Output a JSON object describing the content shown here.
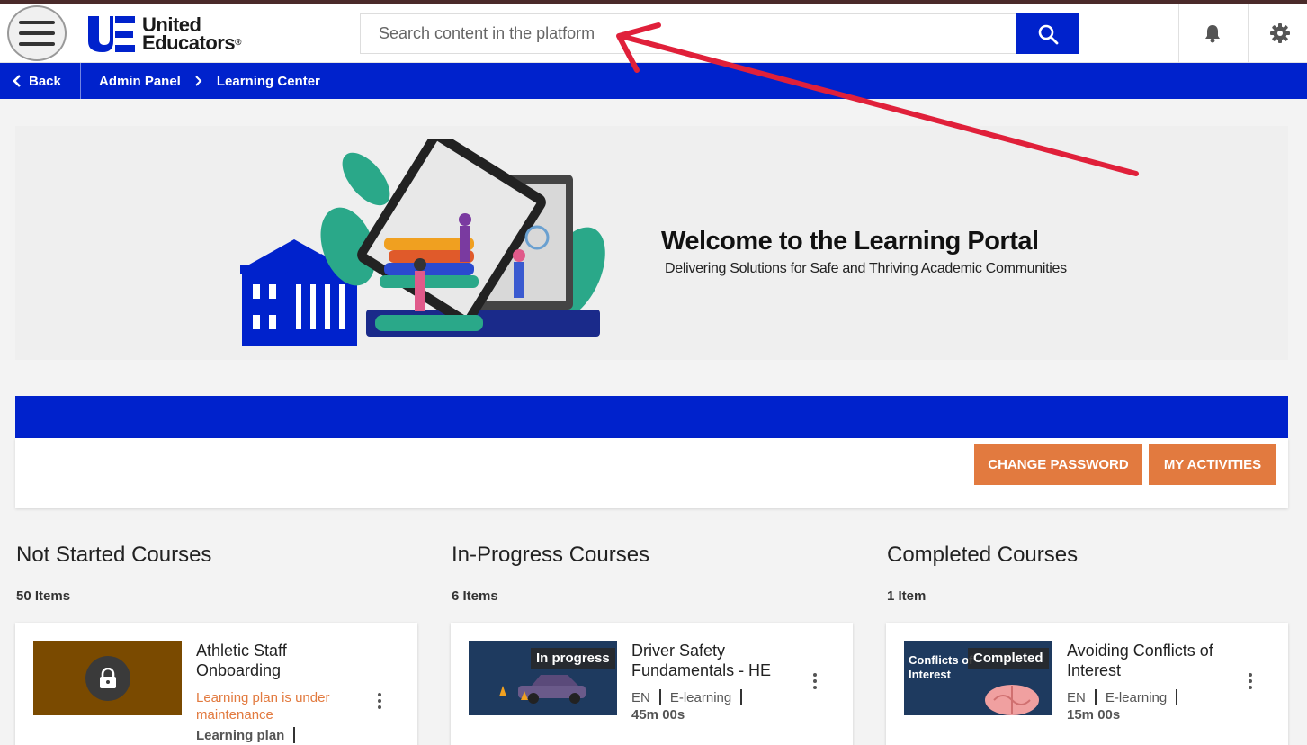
{
  "header": {
    "logo_line1": "United",
    "logo_line2": "Educators",
    "logo_mark": "®",
    "search_placeholder": "Search content in the platform"
  },
  "icons": {
    "menu": "hamburger-icon",
    "search": "search-icon",
    "notifications": "bell-icon",
    "settings": "gear-icon",
    "back": "chevron-left-icon",
    "crumb_sep": "chevron-right-icon"
  },
  "breadcrumb": {
    "back": "Back",
    "items": [
      "Admin Panel",
      "Learning Center"
    ]
  },
  "banner": {
    "title": "Welcome to the Learning Portal",
    "subtitle": "Delivering Solutions for Safe and Thriving Academic Communities"
  },
  "actions": {
    "change_password": "CHANGE PASSWORD",
    "my_activities": "MY ACTIVITIES"
  },
  "columns": [
    {
      "title": "Not Started Courses",
      "count": "50 Items",
      "card": {
        "title": "Athletic Staff Onboarding",
        "warning": "Learning plan is under maintenance",
        "meta": [
          "Learning plan"
        ]
      }
    },
    {
      "title": "In-Progress Courses",
      "count": "6 Items",
      "card": {
        "status": "In progress",
        "title": "Driver Safety Fundamentals - HE",
        "meta": [
          "EN",
          "E-learning"
        ],
        "duration": "45m 00s"
      }
    },
    {
      "title": "Completed Courses",
      "count": "1 Item",
      "card": {
        "status": "Completed",
        "thumb_text": "Conflicts of Interest",
        "title": "Avoiding Conflicts of Interest",
        "meta": [
          "EN",
          "E-learning"
        ],
        "duration": "15m 00s"
      }
    }
  ],
  "colors": {
    "brand_blue": "#0022cc",
    "accent_orange": "#e27a3f",
    "annotation_red": "#e0203a"
  }
}
